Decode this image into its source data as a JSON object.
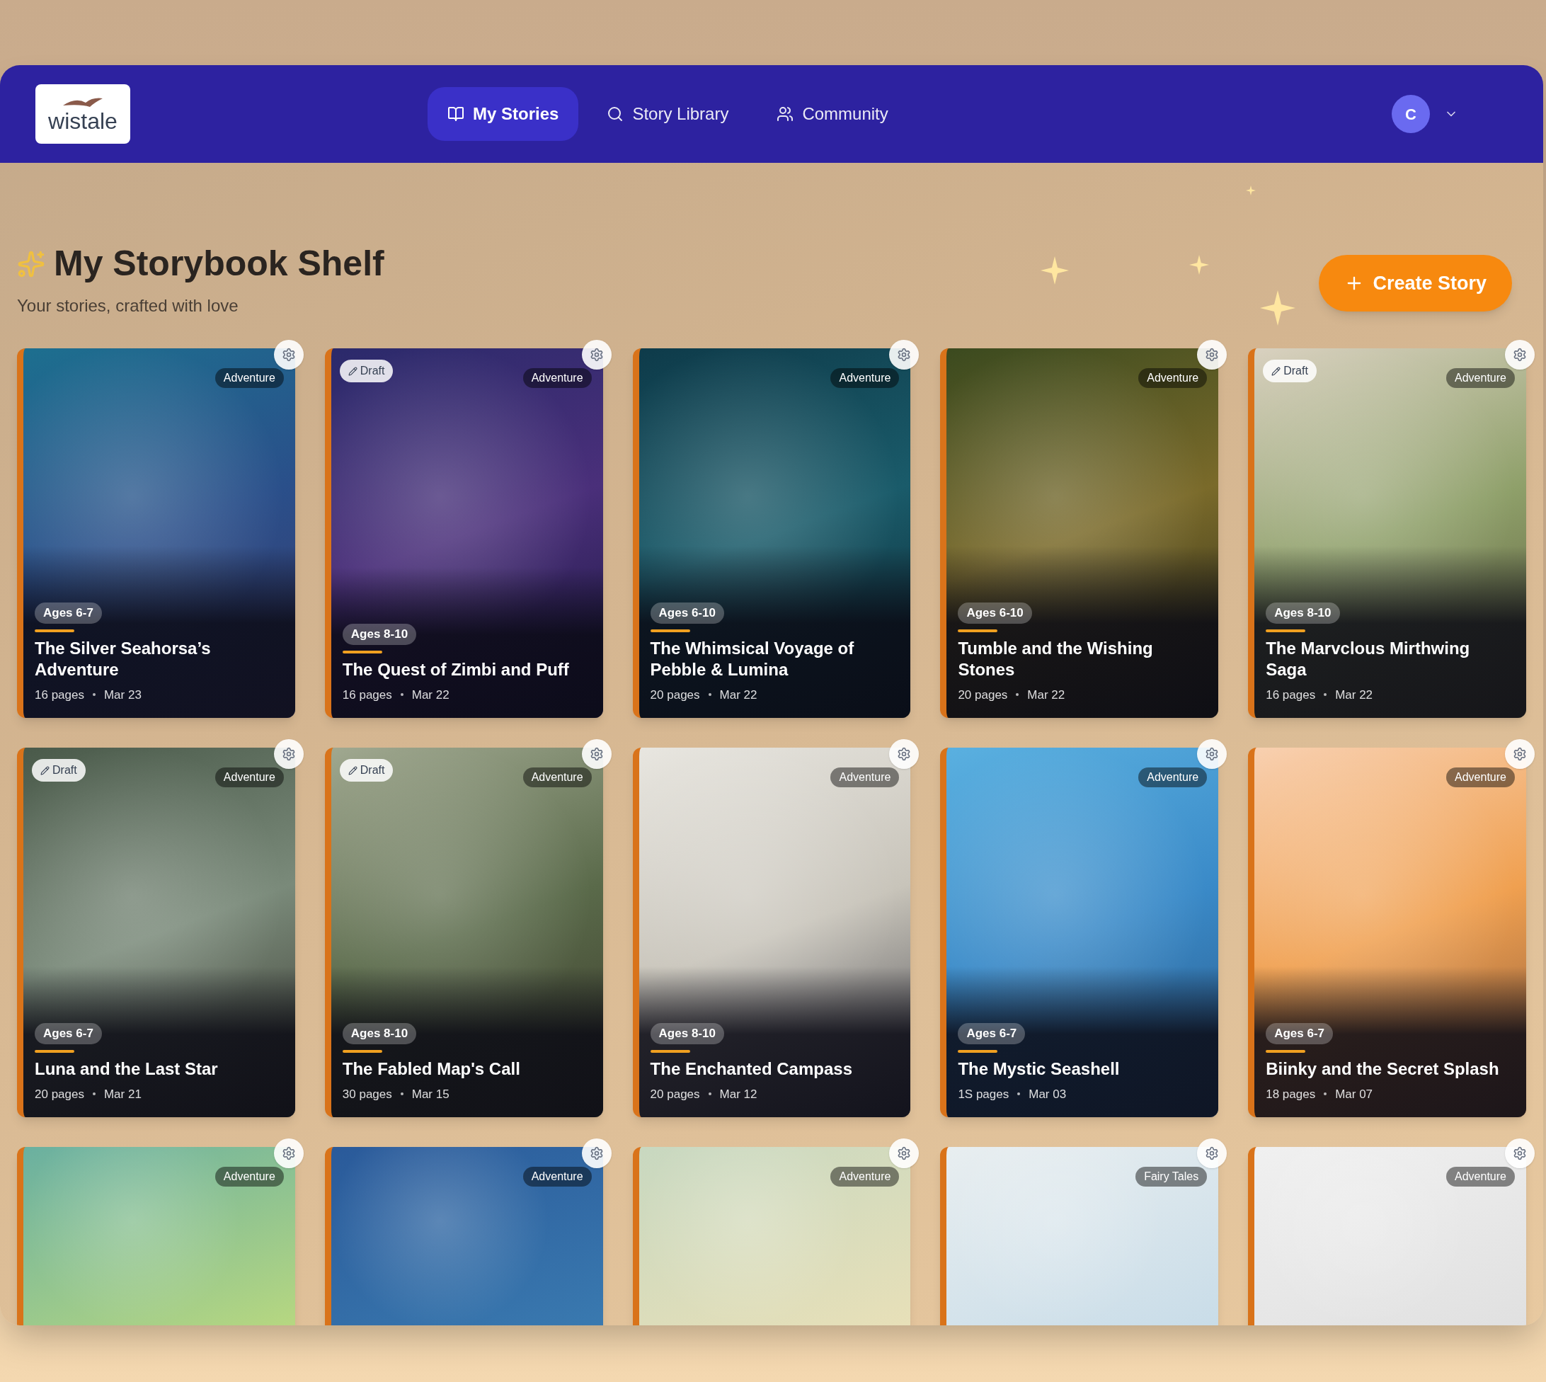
{
  "header": {
    "logo": "wistale",
    "nav": [
      {
        "label": "My Stories",
        "selected": true
      },
      {
        "label": "Story Library",
        "selected": false
      },
      {
        "label": "Community",
        "selected": false
      }
    ],
    "avatar": "C"
  },
  "page": {
    "title": "My Storybook Shelf",
    "subtitle": "Your stories, crafted with love",
    "create_button": "Create Story"
  },
  "stories": [
    {
      "title": "The Silver Seahorsa’s Adventure",
      "ages": "Ages 6-7",
      "pages": "16 pages",
      "date": "Mar 23",
      "genre": "Adventure",
      "draft": false
    },
    {
      "title": "The Quest of Zimbi and Puff",
      "ages": "Ages 8-10",
      "pages": "16 pages",
      "date": "Mar 22",
      "genre": "Adventure",
      "draft": true,
      "draft_label": "Draft"
    },
    {
      "title": "The Whimsical Voyage of Pebble & Lumina",
      "ages": "Ages 6-10",
      "pages": "20 pages",
      "date": "Mar 22",
      "genre": "Adventure",
      "draft": false
    },
    {
      "title": "Tumble and the Wishing Stones",
      "ages": "Ages 6-10",
      "pages": "20 pages",
      "date": "Mar 22",
      "genre": "Adventure",
      "draft": false
    },
    {
      "title": "The Marvclous Mirthwing Saga",
      "ages": "Ages 8-10",
      "pages": "16 pages",
      "date": "Mar 22",
      "genre": "Adventure",
      "draft": true,
      "draft_label": "Draft"
    },
    {
      "title": "Luna and the Last Star",
      "ages": "Ages 6-7",
      "pages": "20 pages",
      "date": "Mar 21",
      "genre": "Adventure",
      "draft": true,
      "draft_label": "Draft"
    },
    {
      "title": "The Fabled Map's Call",
      "ages": "Ages 8-10",
      "pages": "30 pages",
      "date": "Mar 15",
      "genre": "Adventure",
      "draft": true,
      "draft_label": "Draft"
    },
    {
      "title": "The Enchanted Campass",
      "ages": "Ages 8-10",
      "pages": "20 pages",
      "date": "Mar 12",
      "genre": "Adventure",
      "draft": false
    },
    {
      "title": "The Mystic Seashell",
      "ages": "Ages 6-7",
      "pages": "1S pages",
      "date": "Mar 03",
      "genre": "Adventure",
      "draft": false
    },
    {
      "title": "Biinky and the Secret Splash",
      "ages": "Ages 6-7",
      "pages": "18 pages",
      "date": "Mar 07",
      "genre": "Adventure",
      "draft": false
    },
    {
      "genre": "Adventure",
      "draft": false
    },
    {
      "genre": "Adventure",
      "draft": false
    },
    {
      "genre": "Adventure",
      "draft": false
    },
    {
      "genre": "Fairy Tales",
      "draft": false
    },
    {
      "genre": "Adventure",
      "draft": false
    }
  ]
}
